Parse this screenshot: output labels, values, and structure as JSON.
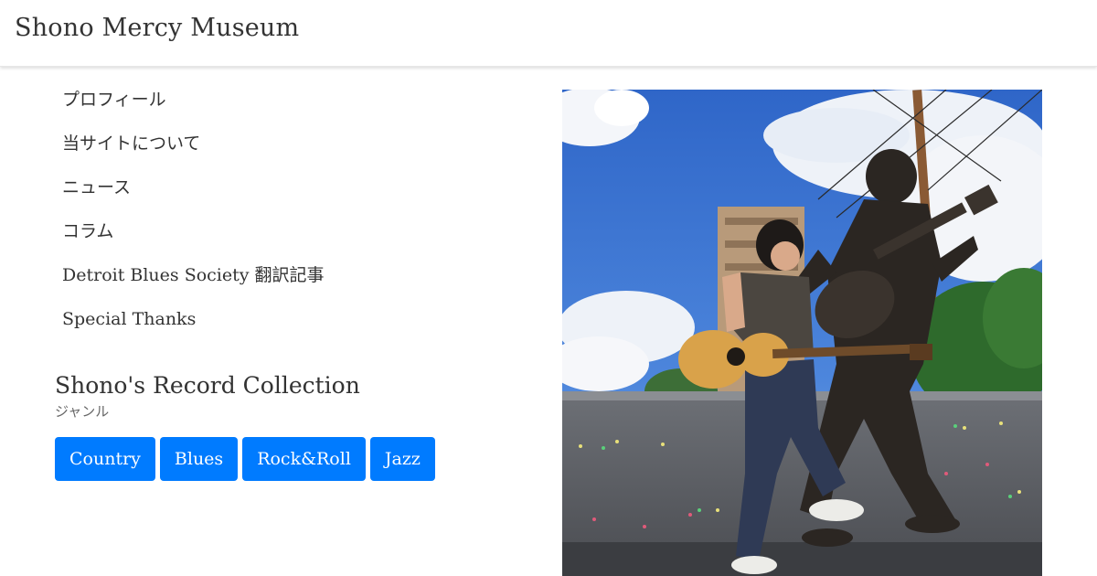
{
  "header": {
    "brand": "Shono Mercy Museum"
  },
  "menu": {
    "items": [
      {
        "label": "プロフィール"
      },
      {
        "label": "当サイトについて"
      },
      {
        "label": "ニュース"
      },
      {
        "label": "コラム"
      },
      {
        "label": "Detroit Blues Society 翻訳記事"
      },
      {
        "label": "Special Thanks"
      }
    ]
  },
  "record_collection": {
    "title": "Shono's Record Collection",
    "subtitle": "ジャンル",
    "genres": [
      {
        "label": "Country"
      },
      {
        "label": "Blues"
      },
      {
        "label": "Rock&Roll"
      },
      {
        "label": "Jazz"
      }
    ]
  },
  "colors": {
    "accent": "#007bff"
  }
}
